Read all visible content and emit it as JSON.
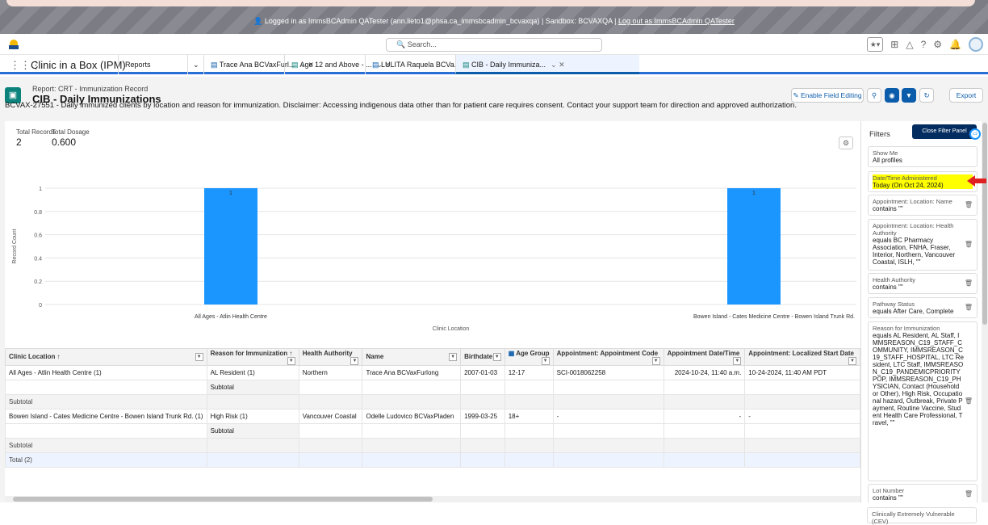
{
  "sandbox": {
    "logged_in_text": "Logged in as ImmsBCAdmin QATester (ann.lieto1@phsa.ca_immsbcadmin_bcvaxqa) | Sandbox: BCVAXQA |",
    "logout_link": "Log out as ImmsBCAdmin QATester"
  },
  "header": {
    "search_placeholder": "Search..."
  },
  "nav": {
    "app_name": "Clinic in a Box (IPM)",
    "reports": "Reports",
    "tabs": [
      {
        "label": "Trace Ana BCVaxFurl..."
      },
      {
        "label": "Age 12 and Above - ..."
      },
      {
        "label": "LULITA Raquela BCVa..."
      },
      {
        "label": "CIB - Daily Immuniza..."
      }
    ]
  },
  "report": {
    "type": "Report: CRT - Immunization Record",
    "title": "CIB - Daily Immunizations",
    "description": "BCVAX-27551 - Daily immunized clients by location and reason for immunization. Disclaimer: Accessing indigenous data other than for patient care requires consent. Contact your support team for direction and approved authorization.",
    "enable_field_editing": "Enable Field Editing",
    "export": "Export"
  },
  "kpis": {
    "total_records_label": "Total Records",
    "total_records": "2",
    "total_dosage_label": "Total Dosage",
    "total_dosage": "0.600"
  },
  "chart_data": {
    "type": "bar",
    "categories": [
      "All Ages - Atlin Health Centre",
      "Bowen Island - Cates Medicine Centre - Bowen Island Trunk Rd."
    ],
    "values": [
      1,
      1
    ],
    "data_labels": [
      "1",
      "1"
    ],
    "xlabel": "Clinic Location",
    "ylabel": "Record Count",
    "ylim": [
      0,
      1
    ],
    "y_ticks": [
      "0",
      "0.2",
      "0.4",
      "0.6",
      "0.8",
      "1"
    ],
    "bar_color": "#1b96ff",
    "grid": true
  },
  "table": {
    "headers": [
      "Clinic Location ↑",
      "Reason for Immunization ↑",
      "Health Authority",
      "Name",
      "Birthdate",
      "Age Group",
      "Appointment: Appointment Code",
      "Appointment Date/Time",
      "Appointment: Localized Start Date"
    ],
    "group1": {
      "location": "All Ages - Atlin Health Centre (1)",
      "reason": "AL Resident (1)",
      "authority": "Northern",
      "name": "Trace Ana BCVaxFurlong",
      "birthdate": "2007-01-03",
      "age_group": "12-17",
      "code": "SCI-0018062258",
      "datetime": "2024-10-24, 11:40 a.m.",
      "localized": "10-24-2024, 11:40 AM PDT",
      "subtotal": "Subtotal"
    },
    "subtotal_label": "Subtotal",
    "group2": {
      "location": "Bowen Island - Cates Medicine Centre - Bowen Island Trunk Rd. (1)",
      "reason": "High Risk (1)",
      "authority": "Vancouver Coastal",
      "name": "Odelle Ludovico BCVaxPladen",
      "birthdate": "1999-03-25",
      "age_group": "18+",
      "code": "-",
      "datetime": "-",
      "localized": "-",
      "subtotal": "Subtotal"
    },
    "subtotal2_label": "Subtotal",
    "total_label": "Total (2)"
  },
  "filters": {
    "title": "Filters",
    "close_panel": "Close Filter Panel",
    "items": [
      {
        "label": "Show Me",
        "value": "All profiles"
      },
      {
        "label": "Date/Time Administered",
        "value": "Today (On Oct 24, 2024)"
      },
      {
        "label": "Appointment: Location: Name",
        "value": "contains \"\""
      },
      {
        "label": "Appointment: Location: Health Authority",
        "value": "equals BC Pharmacy Association, FNHA, Fraser, Interior, Northern, Vancouver Coastal, ISLH, \"\""
      },
      {
        "label": "Health Authority",
        "value": "contains \"\""
      },
      {
        "label": "Pathway Status",
        "value": "equals After Care, Complete"
      },
      {
        "label": "Reason for Immunization",
        "value": "equals AL Resident, AL Staff, IMMSREASON_C19_STAFF_COMMUNITY, IMMSREASON_C19_STAFF_HOSPITAL, LTC Resident, LTC Staff, IMMSREASON_C19_PANDEMICPRIORITYPOP, IMMSREASON_C19_PHYSICIAN, Contact (Household or Other), High Risk, Occupational hazard, Outbreak, Private Payment, Routine Vaccine, Student Health Care Professional, Travel, \"\""
      },
      {
        "label": "Lot Number",
        "value": "contains \"\""
      },
      {
        "label": "Clinically Extremely Vulnerable (CEV)",
        "value": ""
      }
    ]
  },
  "colors": {
    "accent": "#0b5cab",
    "bar": "#1b96ff",
    "highlight": "#ffff00",
    "annotation_arrow": "#e02020"
  }
}
